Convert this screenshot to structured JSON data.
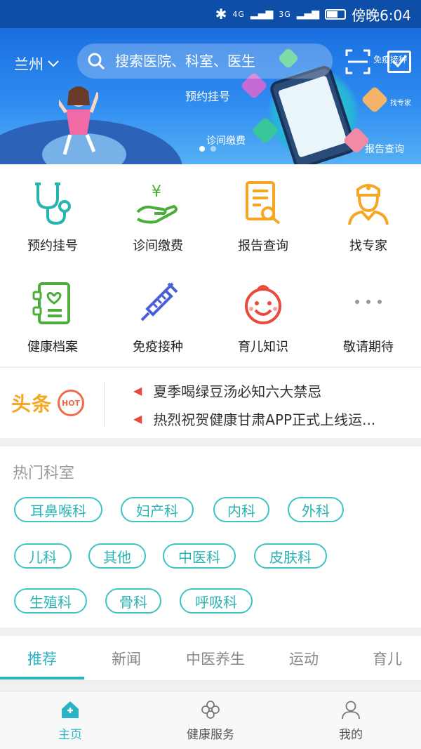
{
  "status_bar": {
    "network1": "4G",
    "network2": "3G",
    "time": "傍晚6:04"
  },
  "header": {
    "city": "兰州",
    "search_placeholder": "搜索医院、科室、医生"
  },
  "banner": {
    "labels": [
      "预约挂号",
      "诊间缴费",
      "报告查询",
      "找专家",
      "免疫接种"
    ],
    "active_slide": 1,
    "slide_count": 2
  },
  "services": [
    {
      "label": "预约挂号",
      "icon": "stethoscope-icon"
    },
    {
      "label": "诊间缴费",
      "icon": "payment-hand-icon"
    },
    {
      "label": "报告查询",
      "icon": "report-search-icon"
    },
    {
      "label": "找专家",
      "icon": "doctor-icon"
    },
    {
      "label": "健康档案",
      "icon": "health-record-icon"
    },
    {
      "label": "免疫接种",
      "icon": "syringe-icon"
    },
    {
      "label": "育儿知识",
      "icon": "baby-face-icon"
    },
    {
      "label": "敬请期待",
      "icon": "more-dots-icon"
    }
  ],
  "news": {
    "logo_text": "头条",
    "hot_badge": "HOT",
    "items": [
      "夏季喝绿豆汤必知六大禁忌",
      "热烈祝贺健康甘肃APP正式上线运..."
    ]
  },
  "departments": {
    "title": "热门科室",
    "items": [
      "耳鼻喉科",
      "妇产科",
      "内科",
      "外科",
      "儿科",
      "其他",
      "中医科",
      "皮肤科",
      "生殖科",
      "骨科",
      "呼吸科"
    ]
  },
  "tabs": [
    "推荐",
    "新闻",
    "中医养生",
    "运动",
    "育儿"
  ],
  "bottom_nav": [
    {
      "label": "主页",
      "icon": "home-icon",
      "active": true
    },
    {
      "label": "健康服务",
      "icon": "flower-icon",
      "active": false
    },
    {
      "label": "我的",
      "icon": "user-icon",
      "active": false
    }
  ],
  "colors": {
    "accent": "#2bb3c4",
    "banner": "#1a6fe0",
    "tag_border": "#3cc4c4",
    "hot": "#f06a4a",
    "headline": "#f5a623"
  }
}
